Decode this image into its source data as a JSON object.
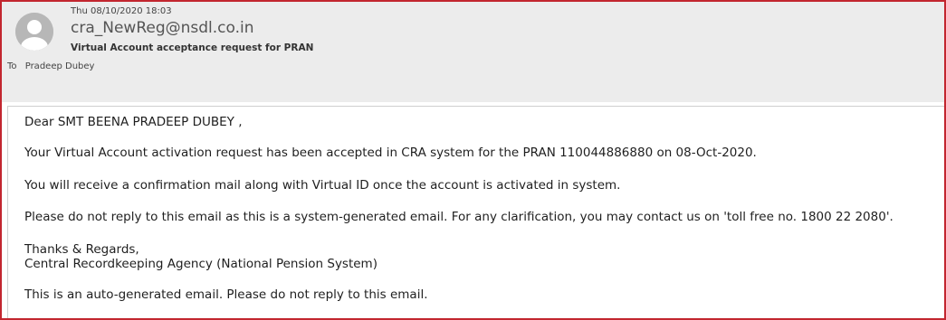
{
  "header": {
    "date": "Thu 08/10/2020 18:03",
    "sender": "cra_NewReg@nsdl.co.in",
    "subject": "Virtual Account acceptance request for PRAN",
    "to_label": "To",
    "to_name": "Pradeep Dubey"
  },
  "body": {
    "greeting": "Dear SMT BEENA PRADEEP DUBEY ,",
    "para1": "Your Virtual Account activation request has been accepted in CRA system for the PRAN 110044886880 on 08-Oct-2020.",
    "para2": "You will receive a confirmation mail along with Virtual ID once the account is activated in system.",
    "para3": "Please do not reply to this email as this is a system-generated email. For any clarification, you may contact us on 'toll free no. 1800 22 2080'.",
    "signoff": "Thanks & Regards,",
    "org": "Central Recordkeeping Agency (National Pension System)",
    "footer": "This is an auto-generated email. Please do not reply to this email."
  },
  "icons": {
    "avatar": "person-icon"
  }
}
